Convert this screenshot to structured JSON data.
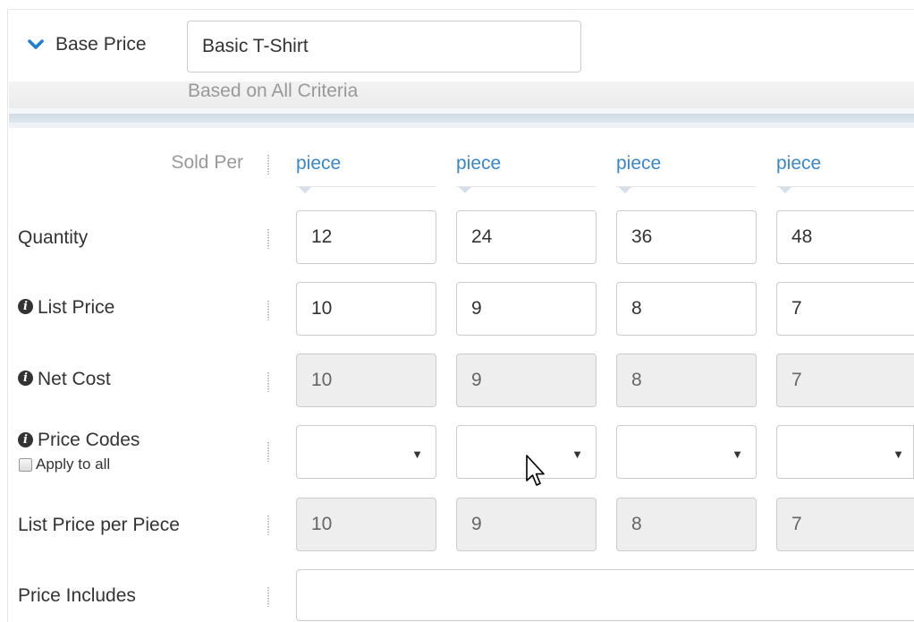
{
  "header": {
    "section_label": "Base Price",
    "product_name": "Basic T-Shirt",
    "criteria_text": "Based on All Criteria"
  },
  "rows": {
    "sold_per": "Sold Per",
    "quantity": "Quantity",
    "list_price": "List Price",
    "net_cost": "Net Cost",
    "price_codes": "Price Codes",
    "apply_to_all": "Apply to all",
    "list_price_per_piece": "List Price per Piece",
    "price_includes": "Price Includes"
  },
  "columns": [
    {
      "unit": "piece",
      "quantity": "12",
      "list_price": "10",
      "net_cost": "10",
      "price_code": "",
      "list_price_per_piece": "10"
    },
    {
      "unit": "piece",
      "quantity": "24",
      "list_price": "9",
      "net_cost": "9",
      "price_code": "",
      "list_price_per_piece": "9"
    },
    {
      "unit": "piece",
      "quantity": "36",
      "list_price": "8",
      "net_cost": "8",
      "price_code": "",
      "list_price_per_piece": "8"
    },
    {
      "unit": "piece",
      "quantity": "48",
      "list_price": "7",
      "net_cost": "7",
      "price_code": "",
      "list_price_per_piece": "7"
    }
  ],
  "price_includes_value": "",
  "icons": {
    "collapse": "chevron-down-icon",
    "info": "info-icon",
    "cursor": "mouse-pointer-icon",
    "dropdown": "caret-down-icon"
  },
  "colors": {
    "link": "#3a87c8",
    "readonly_bg": "#eeeeee",
    "border": "#cccccc"
  }
}
